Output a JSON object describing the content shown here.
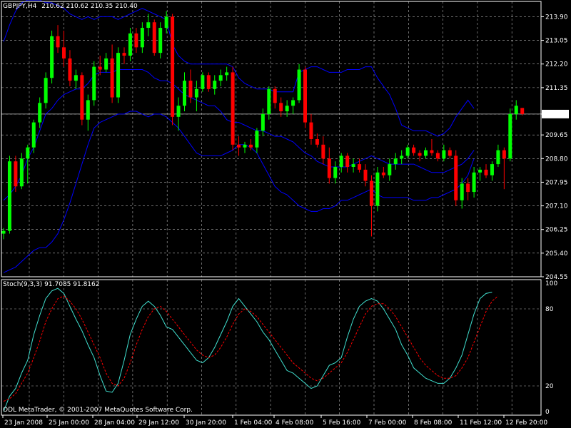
{
  "header": {
    "symbol": "GBPJPY,H4",
    "ohlc": "210.62 210.62 210.35 210.40"
  },
  "indicator_label": "Stoch(9,3,3) 91.7085 91.8162",
  "copyright": "ODL MetaTrader, © 2001-2007 MetaQuotes Software Corp.",
  "colors": {
    "background": "#000000",
    "grid": "#b0b0b0",
    "bull": "#00ff00",
    "bear": "#ff0000",
    "bands": "#0000ff",
    "stoch_main": "#40e0d0",
    "stoch_signal": "#ff0000",
    "price_tag_bg": "#ffffff",
    "price_tag_text": "#000000"
  },
  "chart_data": [
    {
      "type": "candlestick",
      "title": "GBPJPY,H4",
      "y_ticks": [
        213.9,
        213.05,
        212.2,
        211.35,
        210.4,
        209.65,
        208.8,
        207.95,
        207.1,
        206.25,
        205.4,
        204.55
      ],
      "x_ticks": [
        "23 Jan 2008",
        "25 Jan 00:00",
        "28 Jan 04:00",
        "29 Jan 12:00",
        "30 Jan 20:00",
        "1 Feb 04:00",
        "4 Feb 08:00",
        "5 Feb 16:00",
        "7 Feb 00:00",
        "8 Feb 08:00",
        "11 Feb 12:00",
        "12 Feb 20:00"
      ],
      "ylim": [
        204.55,
        214.45
      ],
      "current_price": "210.40",
      "grid": true,
      "candles": [
        {
          "o": 206.1,
          "h": 206.3,
          "l": 205.9,
          "c": 206.2
        },
        {
          "o": 206.2,
          "h": 208.9,
          "l": 206.1,
          "c": 208.7
        },
        {
          "o": 208.7,
          "h": 208.9,
          "l": 207.6,
          "c": 207.8
        },
        {
          "o": 207.8,
          "h": 209.0,
          "l": 207.7,
          "c": 208.8
        },
        {
          "o": 208.8,
          "h": 209.3,
          "l": 207.9,
          "c": 209.2
        },
        {
          "o": 209.2,
          "h": 210.2,
          "l": 209.0,
          "c": 210.1
        },
        {
          "o": 210.1,
          "h": 211.0,
          "l": 209.9,
          "c": 210.8
        },
        {
          "o": 210.8,
          "h": 211.9,
          "l": 210.6,
          "c": 211.7
        },
        {
          "o": 211.7,
          "h": 213.4,
          "l": 211.5,
          "c": 213.2
        },
        {
          "o": 213.2,
          "h": 213.6,
          "l": 212.6,
          "c": 212.8
        },
        {
          "o": 212.8,
          "h": 213.4,
          "l": 212.1,
          "c": 212.4
        },
        {
          "o": 212.4,
          "h": 212.7,
          "l": 211.4,
          "c": 211.6
        },
        {
          "o": 211.6,
          "h": 212.0,
          "l": 211.3,
          "c": 211.8
        },
        {
          "o": 211.8,
          "h": 211.9,
          "l": 210.0,
          "c": 210.2
        },
        {
          "o": 210.2,
          "h": 211.1,
          "l": 209.8,
          "c": 210.9
        },
        {
          "o": 210.9,
          "h": 212.3,
          "l": 210.7,
          "c": 212.1
        },
        {
          "o": 212.1,
          "h": 212.5,
          "l": 211.8,
          "c": 212.0
        },
        {
          "o": 212.0,
          "h": 212.6,
          "l": 211.9,
          "c": 212.4
        },
        {
          "o": 212.4,
          "h": 212.9,
          "l": 210.8,
          "c": 211.0
        },
        {
          "o": 211.0,
          "h": 212.8,
          "l": 210.8,
          "c": 212.6
        },
        {
          "o": 212.6,
          "h": 212.8,
          "l": 212.2,
          "c": 212.5
        },
        {
          "o": 212.5,
          "h": 213.5,
          "l": 212.3,
          "c": 213.3
        },
        {
          "o": 213.3,
          "h": 213.5,
          "l": 212.6,
          "c": 212.8
        },
        {
          "o": 212.8,
          "h": 213.7,
          "l": 212.6,
          "c": 213.5
        },
        {
          "o": 213.5,
          "h": 214.0,
          "l": 213.2,
          "c": 213.7
        },
        {
          "o": 213.7,
          "h": 213.8,
          "l": 212.5,
          "c": 212.6
        },
        {
          "o": 212.6,
          "h": 213.7,
          "l": 212.4,
          "c": 213.5
        },
        {
          "o": 213.5,
          "h": 214.1,
          "l": 213.3,
          "c": 213.9
        },
        {
          "o": 213.9,
          "h": 214.0,
          "l": 210.0,
          "c": 210.3
        },
        {
          "o": 210.3,
          "h": 211.0,
          "l": 209.8,
          "c": 210.7
        },
        {
          "o": 210.7,
          "h": 211.9,
          "l": 210.5,
          "c": 211.6
        },
        {
          "o": 211.6,
          "h": 212.0,
          "l": 210.8,
          "c": 211.0
        },
        {
          "o": 211.0,
          "h": 211.6,
          "l": 210.5,
          "c": 211.3
        },
        {
          "o": 211.3,
          "h": 211.9,
          "l": 211.2,
          "c": 211.8
        },
        {
          "o": 211.8,
          "h": 211.9,
          "l": 211.2,
          "c": 211.3
        },
        {
          "o": 211.3,
          "h": 211.8,
          "l": 211.1,
          "c": 211.6
        },
        {
          "o": 211.6,
          "h": 212.0,
          "l": 211.4,
          "c": 211.8
        },
        {
          "o": 211.8,
          "h": 212.1,
          "l": 211.6,
          "c": 211.9
        },
        {
          "o": 211.9,
          "h": 212.1,
          "l": 209.1,
          "c": 209.3
        },
        {
          "o": 209.3,
          "h": 209.6,
          "l": 208.9,
          "c": 209.2
        },
        {
          "o": 209.2,
          "h": 209.4,
          "l": 209.0,
          "c": 209.3
        },
        {
          "o": 209.3,
          "h": 209.5,
          "l": 209.1,
          "c": 209.2
        },
        {
          "o": 209.2,
          "h": 209.9,
          "l": 209.0,
          "c": 209.8
        },
        {
          "o": 209.8,
          "h": 210.6,
          "l": 209.6,
          "c": 210.4
        },
        {
          "o": 210.4,
          "h": 211.4,
          "l": 210.2,
          "c": 211.3
        },
        {
          "o": 211.3,
          "h": 211.4,
          "l": 210.6,
          "c": 210.8
        },
        {
          "o": 210.8,
          "h": 211.0,
          "l": 210.3,
          "c": 210.5
        },
        {
          "o": 210.5,
          "h": 210.9,
          "l": 210.3,
          "c": 210.7
        },
        {
          "o": 210.7,
          "h": 211.0,
          "l": 210.4,
          "c": 210.9
        },
        {
          "o": 210.9,
          "h": 212.2,
          "l": 210.8,
          "c": 212.0
        },
        {
          "o": 212.0,
          "h": 212.1,
          "l": 209.9,
          "c": 210.1
        },
        {
          "o": 210.1,
          "h": 210.4,
          "l": 209.3,
          "c": 209.5
        },
        {
          "o": 209.5,
          "h": 209.7,
          "l": 209.2,
          "c": 209.3
        },
        {
          "o": 209.3,
          "h": 209.6,
          "l": 208.6,
          "c": 208.8
        },
        {
          "o": 208.8,
          "h": 209.2,
          "l": 207.9,
          "c": 208.1
        },
        {
          "o": 208.1,
          "h": 208.7,
          "l": 207.9,
          "c": 208.5
        },
        {
          "o": 208.5,
          "h": 209.0,
          "l": 208.3,
          "c": 208.9
        },
        {
          "o": 208.9,
          "h": 209.0,
          "l": 208.3,
          "c": 208.5
        },
        {
          "o": 208.5,
          "h": 208.8,
          "l": 208.3,
          "c": 208.6
        },
        {
          "o": 208.6,
          "h": 208.8,
          "l": 208.3,
          "c": 208.4
        },
        {
          "o": 208.4,
          "h": 208.6,
          "l": 207.8,
          "c": 208.0
        },
        {
          "o": 208.0,
          "h": 208.2,
          "l": 206.0,
          "c": 207.1
        },
        {
          "o": 207.1,
          "h": 208.5,
          "l": 206.9,
          "c": 208.3
        },
        {
          "o": 208.3,
          "h": 208.5,
          "l": 208.1,
          "c": 208.2
        },
        {
          "o": 208.2,
          "h": 208.8,
          "l": 208.0,
          "c": 208.6
        },
        {
          "o": 208.6,
          "h": 209.0,
          "l": 208.4,
          "c": 208.8
        },
        {
          "o": 208.8,
          "h": 209.1,
          "l": 208.6,
          "c": 208.9
        },
        {
          "o": 208.9,
          "h": 209.3,
          "l": 208.8,
          "c": 209.2
        },
        {
          "o": 209.2,
          "h": 209.3,
          "l": 208.9,
          "c": 209.0
        },
        {
          "o": 209.0,
          "h": 209.1,
          "l": 208.7,
          "c": 208.9
        },
        {
          "o": 208.9,
          "h": 209.2,
          "l": 208.8,
          "c": 209.1
        },
        {
          "o": 209.1,
          "h": 209.5,
          "l": 208.9,
          "c": 209.0
        },
        {
          "o": 209.0,
          "h": 209.1,
          "l": 208.7,
          "c": 208.8
        },
        {
          "o": 208.8,
          "h": 209.3,
          "l": 208.7,
          "c": 209.1
        },
        {
          "o": 209.1,
          "h": 209.2,
          "l": 208.8,
          "c": 208.9
        },
        {
          "o": 208.9,
          "h": 209.1,
          "l": 207.1,
          "c": 207.3
        },
        {
          "o": 207.3,
          "h": 208.1,
          "l": 207.0,
          "c": 207.9
        },
        {
          "o": 207.9,
          "h": 208.1,
          "l": 207.3,
          "c": 207.6
        },
        {
          "o": 207.6,
          "h": 208.5,
          "l": 207.4,
          "c": 208.3
        },
        {
          "o": 208.3,
          "h": 208.5,
          "l": 208.0,
          "c": 208.4
        },
        {
          "o": 208.4,
          "h": 208.6,
          "l": 208.1,
          "c": 208.2
        },
        {
          "o": 208.2,
          "h": 208.7,
          "l": 208.0,
          "c": 208.6
        },
        {
          "o": 208.6,
          "h": 209.3,
          "l": 208.5,
          "c": 209.1
        },
        {
          "o": 209.1,
          "h": 209.2,
          "l": 207.7,
          "c": 208.8
        },
        {
          "o": 208.8,
          "h": 210.6,
          "l": 208.7,
          "c": 210.4
        },
        {
          "o": 210.4,
          "h": 210.9,
          "l": 210.2,
          "c": 210.7
        },
        {
          "o": 210.62,
          "h": 210.62,
          "l": 210.35,
          "c": 210.4
        }
      ],
      "bollinger": {
        "upper": [
          213.0,
          213.6,
          214.1,
          214.4,
          214.5,
          214.5,
          214.5,
          214.4,
          214.4,
          214.3,
          214.2,
          214.0,
          213.9,
          213.8,
          213.9,
          213.8,
          213.9,
          213.9,
          213.9,
          213.8,
          213.9,
          214.0,
          214.1,
          214.2,
          214.1,
          214.0,
          213.9,
          213.8,
          212.9,
          212.5,
          212.3,
          212.2,
          212.2,
          212.2,
          212.2,
          212.2,
          212.2,
          212.2,
          212.1,
          211.7,
          211.5,
          211.4,
          211.3,
          211.3,
          211.3,
          211.2,
          211.2,
          211.2,
          211.2,
          211.9,
          212.0,
          212.1,
          212.1,
          212.0,
          211.9,
          211.9,
          211.9,
          212.0,
          212.0,
          212.0,
          212.1,
          212.1,
          211.7,
          211.4,
          211.1,
          210.6,
          210.0,
          209.9,
          209.8,
          209.8,
          209.8,
          209.7,
          209.6,
          209.7,
          209.9,
          210.3,
          210.6,
          210.9,
          210.6
        ],
        "middle": [
          207.3,
          207.5,
          207.8,
          208.2,
          208.8,
          209.2,
          209.8,
          210.4,
          210.6,
          210.9,
          211.1,
          211.2,
          211.3,
          211.3,
          211.5,
          211.8,
          211.9,
          211.9,
          211.9,
          212.0,
          212.0,
          212.0,
          212.0,
          212.0,
          211.9,
          211.7,
          211.6,
          211.6,
          211.5,
          211.3,
          211.1,
          211.0,
          210.9,
          210.8,
          210.7,
          210.7,
          210.5,
          210.2,
          210.1,
          210.1,
          210.0,
          209.9,
          209.8,
          209.8,
          209.7,
          209.6,
          209.6,
          209.5,
          209.4,
          209.2,
          209.0,
          208.9,
          208.7,
          208.6,
          208.5,
          208.5,
          208.5,
          208.5,
          208.6,
          208.7,
          208.8,
          208.9,
          208.8,
          208.7,
          208.6,
          208.6,
          208.6,
          208.6,
          208.6,
          208.5,
          208.4,
          208.3,
          208.3,
          208.3,
          208.4,
          208.5,
          208.6,
          208.8,
          209.1
        ],
        "lower": [
          204.7,
          204.8,
          204.9,
          205.1,
          205.3,
          205.5,
          205.6,
          205.6,
          205.8,
          206.1,
          206.6,
          207.2,
          207.9,
          208.6,
          209.3,
          209.9,
          210.1,
          210.2,
          210.3,
          210.4,
          210.4,
          210.5,
          210.5,
          210.4,
          210.3,
          210.4,
          210.4,
          210.3,
          210.1,
          209.9,
          209.6,
          209.3,
          209.0,
          208.9,
          208.9,
          208.9,
          208.9,
          209.0,
          209.1,
          209.3,
          209.3,
          209.2,
          209.0,
          208.6,
          208.2,
          207.8,
          207.6,
          207.5,
          207.3,
          207.1,
          207.0,
          206.9,
          206.9,
          207.0,
          207.0,
          207.1,
          207.3,
          207.3,
          207.4,
          207.5,
          207.6,
          207.7,
          207.5,
          207.4,
          207.4,
          207.4,
          207.4,
          207.4,
          207.3,
          207.3,
          207.3,
          207.4,
          207.4,
          207.5,
          207.6,
          207.7,
          207.9,
          208.2,
          208.8
        ]
      }
    },
    {
      "type": "line",
      "title": "Stoch(9,3,3) 91.7085 91.8162",
      "y_ticks": [
        100,
        80,
        20,
        0
      ],
      "ylim": [
        0,
        100
      ],
      "grid": true,
      "series": [
        {
          "values": [
            0,
            12,
            18,
            30,
            40,
            60,
            75,
            88,
            94,
            96,
            92,
            82,
            72,
            63,
            52,
            42,
            28,
            16,
            15,
            22,
            40,
            60,
            72,
            82,
            86,
            82,
            75,
            66,
            64,
            58,
            52,
            46,
            40,
            38,
            42,
            50,
            60,
            70,
            82,
            88,
            82,
            76,
            70,
            62,
            56,
            48,
            40,
            32,
            30,
            26,
            22,
            18,
            20,
            28,
            36,
            38,
            42,
            58,
            72,
            82,
            86,
            88,
            86,
            80,
            72,
            64,
            52,
            44,
            34,
            30,
            26,
            24,
            22,
            22,
            26,
            34,
            44,
            60,
            76,
            88,
            92,
            93
          ]
        },
        {
          "values": [
            8,
            10,
            14,
            22,
            30,
            42,
            55,
            70,
            80,
            88,
            90,
            86,
            80,
            72,
            62,
            52,
            42,
            30,
            22,
            20,
            26,
            38,
            52,
            64,
            74,
            80,
            82,
            78,
            72,
            66,
            60,
            54,
            48,
            44,
            42,
            44,
            50,
            58,
            68,
            76,
            80,
            78,
            74,
            68,
            62,
            56,
            50,
            44,
            38,
            34,
            30,
            26,
            24,
            26,
            30,
            34,
            38,
            46,
            56,
            66,
            76,
            82,
            84,
            84,
            80,
            74,
            66,
            58,
            50,
            42,
            36,
            32,
            28,
            26,
            26,
            28,
            34,
            42,
            54,
            66,
            78,
            86,
            90
          ]
        }
      ]
    }
  ]
}
